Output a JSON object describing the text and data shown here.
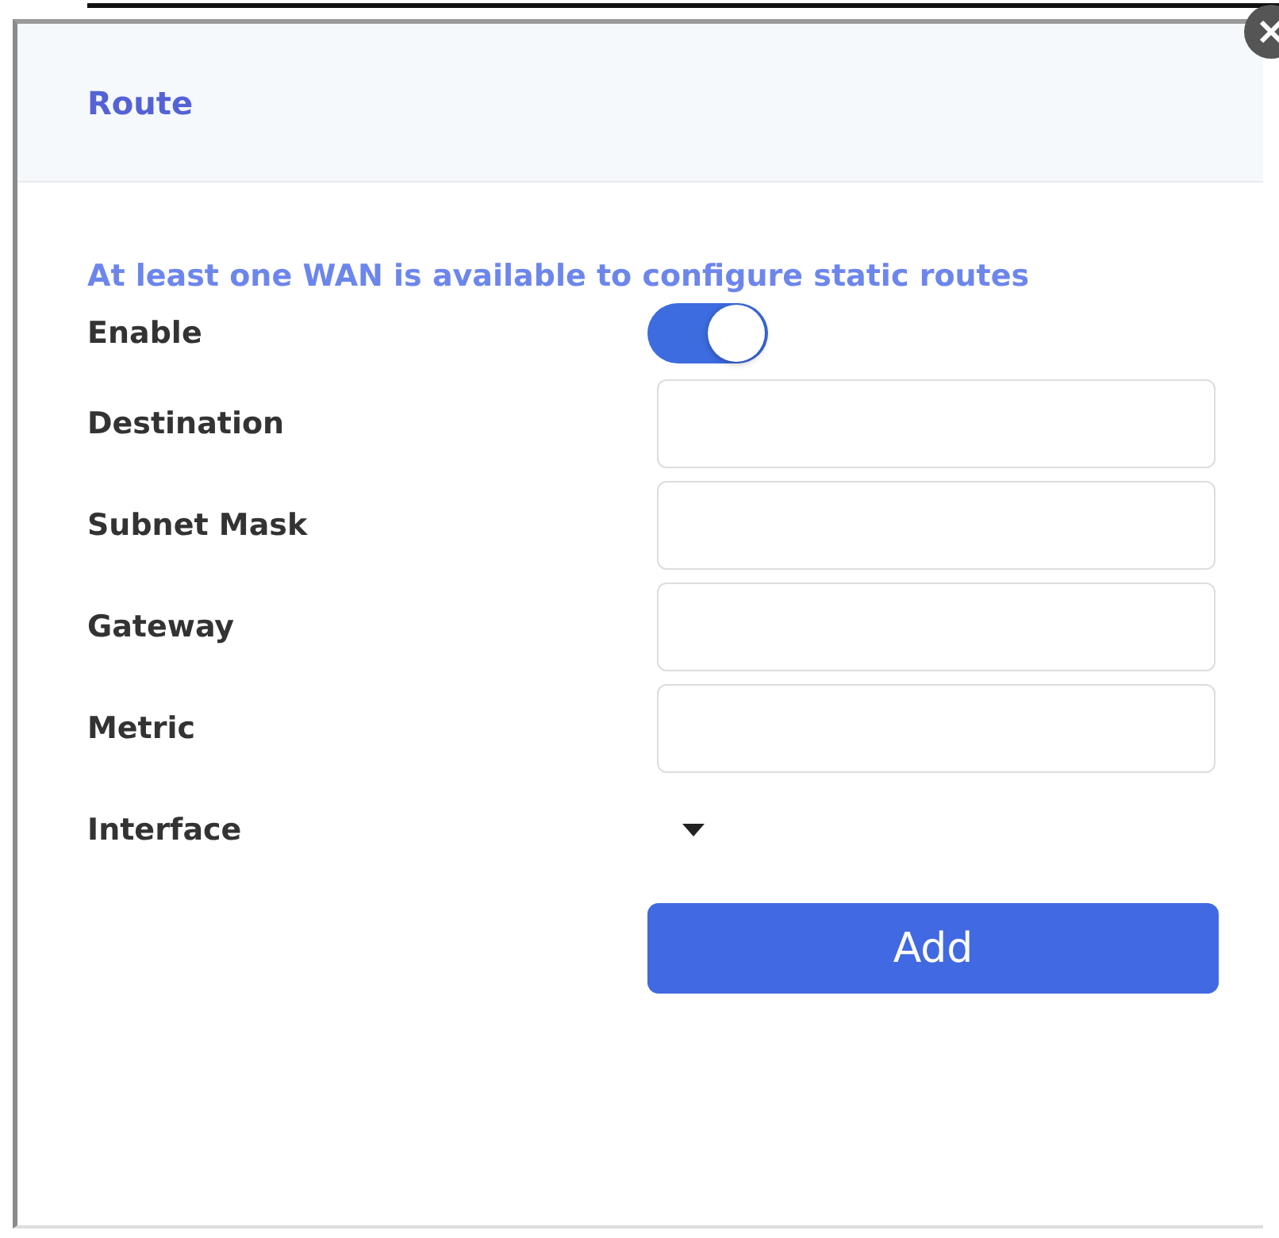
{
  "dialog": {
    "title": "Route"
  },
  "message": "At least one WAN is available to configure static routes",
  "fields": [
    {
      "kind": "toggle",
      "label": "Enable",
      "on": true
    },
    {
      "kind": "text",
      "label": "Destination"
    },
    {
      "kind": "text",
      "label": "Subnet Mask"
    },
    {
      "kind": "text",
      "label": "Gateway"
    },
    {
      "kind": "text",
      "label": "Metric"
    },
    {
      "kind": "dropdown",
      "label": "Interface"
    }
  ],
  "button": "Add"
}
